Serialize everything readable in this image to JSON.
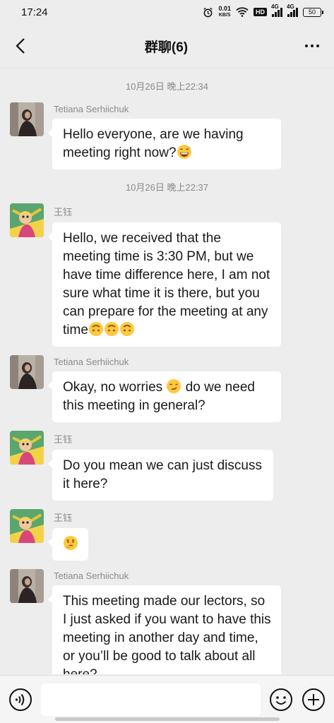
{
  "status_bar": {
    "time": "17:24",
    "speed_value": "0.01",
    "speed_unit": "KB/S",
    "hd_label": "HD",
    "sig1_label": "4G",
    "sig2_label": "4G",
    "battery": "50"
  },
  "header": {
    "title": "群聊(6)"
  },
  "messages": [
    {
      "timestamp": "10月26日 晚上22:34"
    },
    {
      "sender": "Tetiana Serhiichuk",
      "text": "Hello everyone, are we having meeting right now?"
    },
    {
      "timestamp": "10月26日 晚上22:37"
    },
    {
      "sender": "王钰",
      "text": "Hello, we received that the meeting time is 3:30 PM, but we have time difference here, I am not sure what time it is there, but you can prepare for the meeting at any time"
    },
    {
      "sender": "Tetiana Serhiichuk",
      "text": "Okay, no worries",
      "text2": "do we need this meeting in general?"
    },
    {
      "sender": "王钰",
      "text": "Do you mean we can just discuss it here?"
    },
    {
      "sender": "王钰"
    },
    {
      "sender": "Tetiana Serhiichuk",
      "text": "This meeting made our lectors, so I just asked if you want to have this meeting in another day and time, or you’ll be good to talk about all here?"
    }
  ],
  "icons": {
    "back": "chevron-left-icon",
    "more": "more-dots-icon",
    "voice": "voice-icon",
    "emoji": "smiley-icon",
    "plus": "plus-circle-icon"
  },
  "input": {
    "placeholder": ""
  }
}
